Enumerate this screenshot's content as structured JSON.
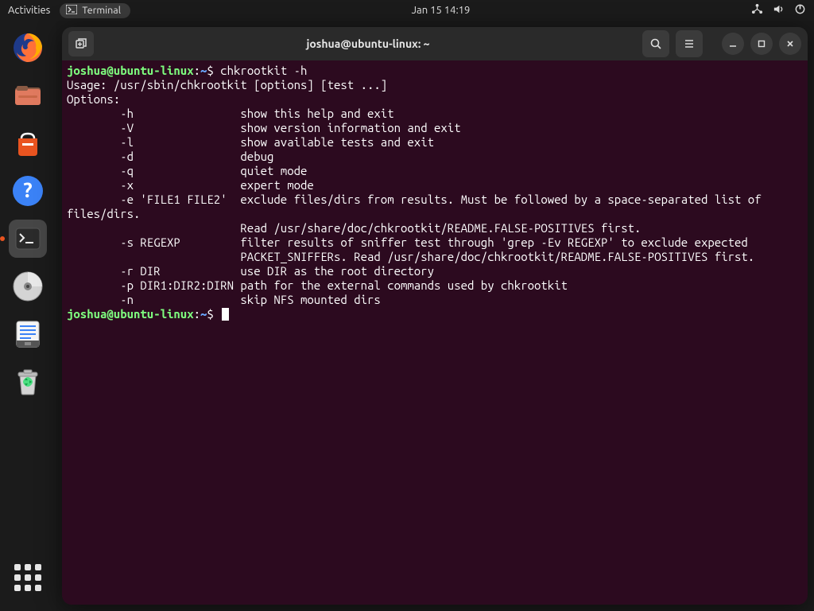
{
  "topbar": {
    "activities": "Activities",
    "app_label": "Terminal",
    "datetime": "Jan 15  14:19"
  },
  "dock": {
    "items": [
      "firefox",
      "files",
      "software",
      "help",
      "terminal",
      "disc",
      "notes",
      "trash"
    ]
  },
  "window": {
    "title": "joshua@ubuntu-linux: ~"
  },
  "terminal": {
    "prompt_user": "joshua@ubuntu-linux",
    "prompt_path": "~",
    "command": "chkrootkit -h",
    "lines": [
      "Usage: /usr/sbin/chkrootkit [options] [test ...]",
      "Options:",
      "        -h                show this help and exit",
      "        -V                show version information and exit",
      "        -l                show available tests and exit",
      "        -d                debug",
      "        -q                quiet mode",
      "        -x                expert mode",
      "        -e 'FILE1 FILE2'  exclude files/dirs from results. Must be followed by a space-separated list of",
      "files/dirs.",
      "                          Read /usr/share/doc/chkrootkit/README.FALSE-POSITIVES first.",
      "        -s REGEXP         filter results of sniffer test through 'grep -Ev REGEXP' to exclude expected",
      "                          PACKET_SNIFFERs. Read /usr/share/doc/chkrootkit/README.FALSE-POSITIVES first.",
      "        -r DIR            use DIR as the root directory",
      "        -p DIR1:DIR2:DIRN path for the external commands used by chkrootkit",
      "        -n                skip NFS mounted dirs"
    ]
  }
}
